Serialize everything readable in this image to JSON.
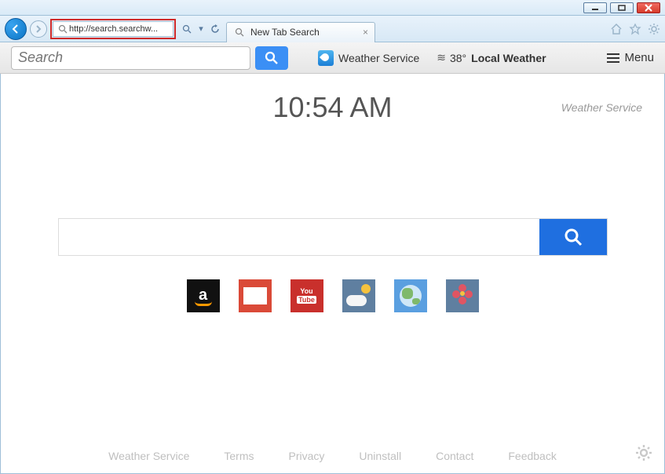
{
  "browser": {
    "url": "http://search.searchw...",
    "tab_title": "New Tab Search"
  },
  "toolbar": {
    "search_placeholder": "Search",
    "weather_service_label": "Weather Service",
    "temperature": "38°",
    "local_weather_label": "Local Weather",
    "menu_label": "Menu"
  },
  "page": {
    "clock": "10:54 AM",
    "service_name": "Weather Service",
    "main_search_placeholder": "",
    "tiles": {
      "amazon": "amazon",
      "gmail": "gmail",
      "youtube_top": "You",
      "youtube_bottom": "Tube",
      "weather": "weather",
      "globe": "globe",
      "flower": "flower"
    }
  },
  "footer": {
    "links": [
      "Weather Service",
      "Terms",
      "Privacy",
      "Uninstall",
      "Contact",
      "Feedback"
    ]
  }
}
